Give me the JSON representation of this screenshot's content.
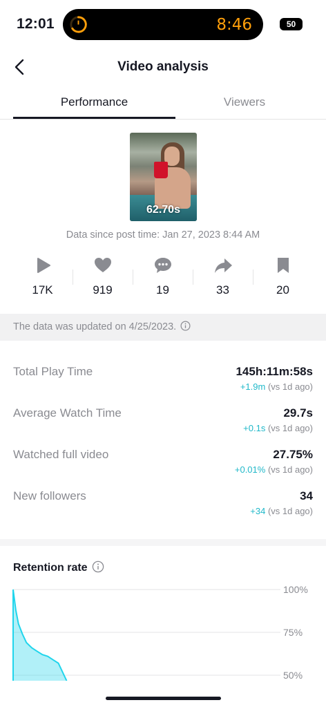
{
  "status_bar": {
    "time": "12:01",
    "timer": "8:46",
    "battery": "50"
  },
  "header": {
    "title": "Video analysis",
    "back_icon": "chevron-left-icon"
  },
  "tabs": [
    {
      "label": "Performance",
      "active": true
    },
    {
      "label": "Viewers",
      "active": false
    }
  ],
  "video": {
    "duration": "62.70s",
    "data_since": "Data since post time: Jan 27, 2023 8:44 AM"
  },
  "stats": [
    {
      "icon": "play-icon",
      "value": "17K"
    },
    {
      "icon": "heart-icon",
      "value": "919"
    },
    {
      "icon": "comment-icon",
      "value": "19"
    },
    {
      "icon": "share-icon",
      "value": "33"
    },
    {
      "icon": "bookmark-icon",
      "value": "20"
    }
  ],
  "update_notice": "The data was updated on 4/25/2023.",
  "metrics": [
    {
      "label": "Total Play Time",
      "value": "145h:11m:58s",
      "delta": "+1.9m",
      "compare": "(vs 1d ago)"
    },
    {
      "label": "Average Watch Time",
      "value": "29.7s",
      "delta": "+0.1s",
      "compare": "(vs 1d ago)"
    },
    {
      "label": "Watched full video",
      "value": "27.75%",
      "delta": "+0.01%",
      "compare": "(vs 1d ago)"
    },
    {
      "label": "New followers",
      "value": "34",
      "delta": "+34",
      "compare": "(vs 1d ago)"
    }
  ],
  "retention": {
    "title": "Retention rate"
  },
  "colors": {
    "accent": "#20b8c9",
    "timer": "#ff9f0a",
    "text_primary": "#161823",
    "text_secondary": "#8a8b91",
    "icon_gray": "#8a8b91"
  },
  "chart_data": {
    "type": "area",
    "title": "Retention rate",
    "y_tick_labels": [
      "100%",
      "75%",
      "50%"
    ],
    "ylim": [
      50,
      100
    ],
    "x_unit": "fraction of visible chart width",
    "x": [
      0.0,
      0.01,
      0.02,
      0.035,
      0.05,
      0.07,
      0.09,
      0.11,
      0.13,
      0.15,
      0.17
    ],
    "y": [
      100,
      88,
      80,
      74,
      69,
      66,
      64,
      62,
      61,
      59,
      57
    ],
    "grid": true,
    "line_color": "#20d5ec"
  }
}
